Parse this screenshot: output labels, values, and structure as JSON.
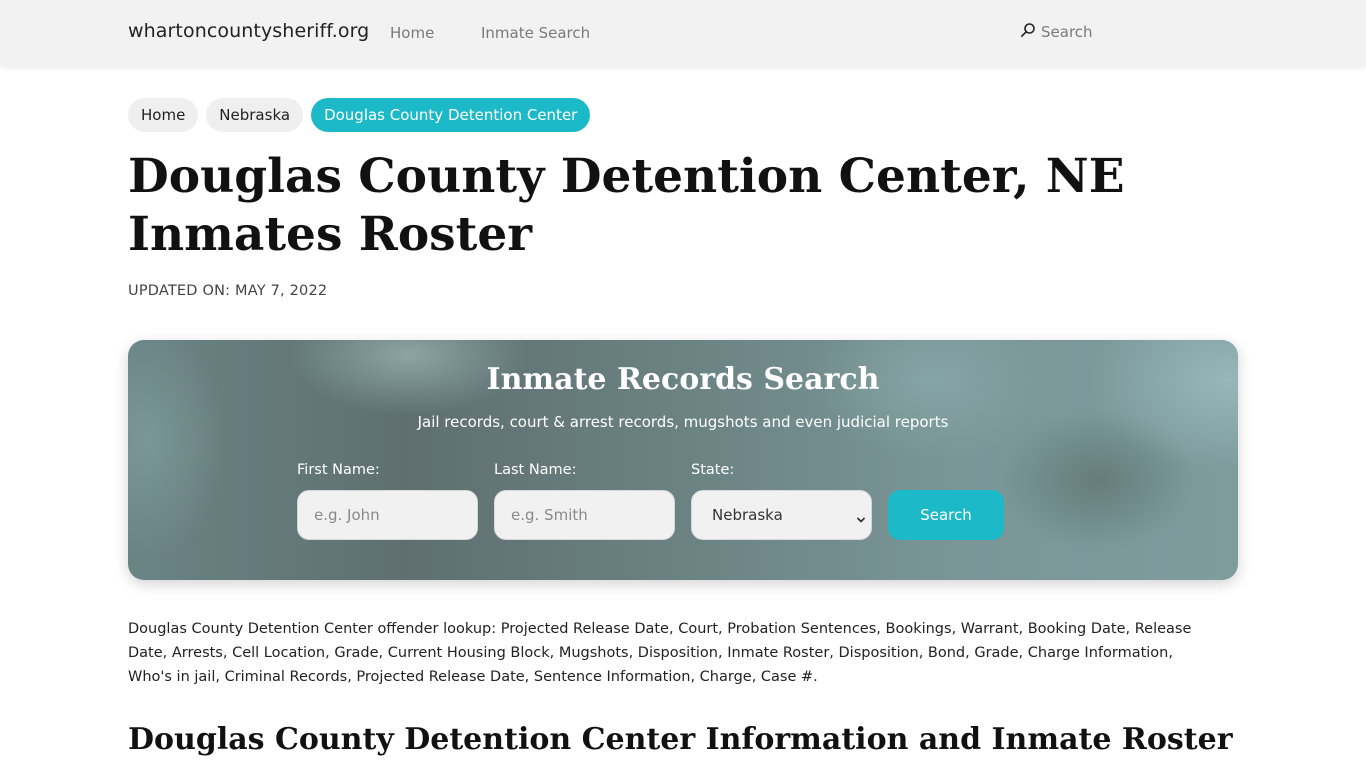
{
  "navbar": {
    "brand": "whartoncountysheriff.org",
    "links": [
      {
        "label": "Home"
      },
      {
        "label": "Inmate Search"
      }
    ],
    "search_label": "Search",
    "search_icon": "search-icon"
  },
  "breadcrumb": [
    {
      "label": "Home",
      "active": false
    },
    {
      "label": "Nebraska",
      "active": false
    },
    {
      "label": "Douglas County Detention Center",
      "active": true
    }
  ],
  "page": {
    "title": "Douglas County Detention Center, NE Inmates Roster",
    "updated": "UPDATED ON: MAY 7, 2022"
  },
  "search_form": {
    "title": "Inmate Records Search",
    "subtitle": "Jail records, court & arrest records, mugshots and even judicial reports",
    "first_name": {
      "label": "First Name:",
      "placeholder": "e.g. John",
      "value": ""
    },
    "last_name": {
      "label": "Last Name:",
      "placeholder": "e.g. Smith",
      "value": ""
    },
    "state": {
      "label": "State:",
      "selected": "Nebraska"
    },
    "submit_label": "Search"
  },
  "content": {
    "description": "Douglas County Detention Center offender lookup: Projected Release Date, Court, Probation Sentences, Bookings, Warrant, Booking Date, Release Date, Arrests, Cell Location, Grade, Current Housing Block, Mugshots, Disposition, Inmate Roster, Disposition, Bond, Grade, Charge Information, Who's in jail, Criminal Records, Projected Release Date, Sentence Information, Charge, Case #.",
    "section_title": "Douglas County Detention Center Information and Inmate Roster"
  },
  "colors": {
    "accent": "#1cb9c8",
    "navbar_bg": "#f2f2f2",
    "crumb_bg": "#efefef"
  }
}
